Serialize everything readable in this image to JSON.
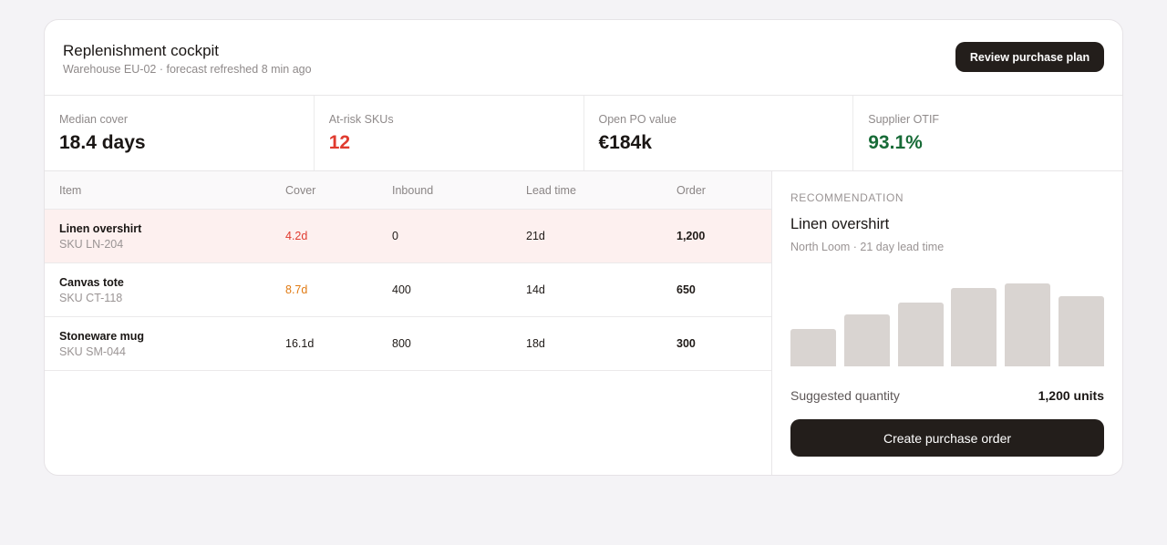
{
  "header": {
    "title": "Replenishment cockpit",
    "subtitle": "Warehouse EU-02 · forecast refreshed 8 min ago",
    "review_button": "Review purchase plan"
  },
  "kpis": [
    {
      "label": "Median cover",
      "value": "18.4 days",
      "color": "#1a1614"
    },
    {
      "label": "At-risk SKUs",
      "value": "12",
      "color": "#e03b2f"
    },
    {
      "label": "Open PO value",
      "value": "€184k",
      "color": "#1a1614"
    },
    {
      "label": "Supplier OTIF",
      "value": "93.1%",
      "color": "#176b37"
    }
  ],
  "table": {
    "columns": [
      "Item",
      "Cover",
      "Inbound",
      "Lead time",
      "Order"
    ],
    "rows": [
      {
        "name": "Linen overshirt",
        "sku": "SKU LN-204",
        "cover": "4.2d",
        "inbound": "0",
        "lead": "21d",
        "order": "1,200",
        "status": "red"
      },
      {
        "name": "Canvas tote",
        "sku": "SKU CT-118",
        "cover": "8.7d",
        "inbound": "400",
        "lead": "14d",
        "order": "650",
        "status": "orange"
      },
      {
        "name": "Stoneware mug",
        "sku": "SKU SM-044",
        "cover": "16.1d",
        "inbound": "800",
        "lead": "18d",
        "order": "300",
        "status": "normal"
      }
    ]
  },
  "recommendation": {
    "label": "RECOMMENDATION",
    "title": "Linen overshirt",
    "subtitle": "North Loom · 21 day lead time",
    "bar_levels": [
      0.45,
      0.63,
      0.77,
      0.94,
      1.0,
      0.85
    ],
    "suggested_label": "Suggested quantity",
    "suggested_value": "1,200 units",
    "create_button": "Create purchase order"
  },
  "colors": {
    "accent_dark": "#231e1b",
    "risk_red": "#e03b2f",
    "warn_orange": "#e07a12",
    "ok_green": "#176b37",
    "alert_row_bg": "#fdf0ef",
    "bar_fill": "#d9d4d1"
  }
}
